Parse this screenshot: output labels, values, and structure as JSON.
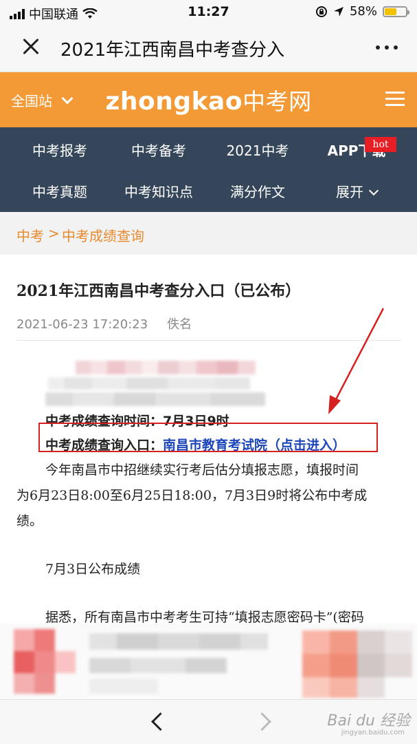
{
  "status_bar": {
    "carrier": "中国联通",
    "time": "11:27",
    "battery": "58%",
    "battery_level": 0.58,
    "icons": [
      "signal-icon",
      "wifi-icon",
      "orientation-lock-icon",
      "location-icon",
      "battery-icon"
    ]
  },
  "nav_bar": {
    "title": "2021年江西南昌中考查分入"
  },
  "site_header": {
    "station_label": "全国站",
    "logo_latin": "zhongkao",
    "logo_cn": "中考网"
  },
  "category_nav": {
    "row1": [
      "中考报考",
      "中考备考",
      "2021中考",
      "APP下载"
    ],
    "row2": [
      "中考真题",
      "中考知识点",
      "满分作文",
      "展开"
    ],
    "hot_badge": "hot"
  },
  "breadcrumb": {
    "home": "中考",
    "separator": ">",
    "current": "中考成绩查询"
  },
  "article": {
    "title": "2021年江西南昌中考查分入口（已公布）",
    "date": "2021-06-23 17:20:23",
    "author": "佚名",
    "time_label": "中考成绩查询时间：",
    "time_value": "7月3日9时",
    "entry_label": "中考成绩查询入口：",
    "entry_link": "南昌市教育考试院（点击进入）",
    "para1_line1": "今年南昌市中招继续实行考后估分填报志愿，填报时间",
    "para1_line2": "为6月23日8:00至6月25日18:00，7月3日9时将公布中考成",
    "para1_line3": "绩。",
    "para2": "7月3日公布成绩",
    "para3": "据悉，所有南昌市中考考生可持“填报志愿密码卡”(密码"
  },
  "watermark": {
    "brand": "Bai du 经验",
    "url": "jingyan.baidu.com"
  },
  "colors": {
    "header_orange": "#f39a36",
    "nav_dark": "#35465a",
    "link_blue": "#1c46b8",
    "highlight_red": "#d62020",
    "breadcrumb_orange": "#e88a2e"
  }
}
